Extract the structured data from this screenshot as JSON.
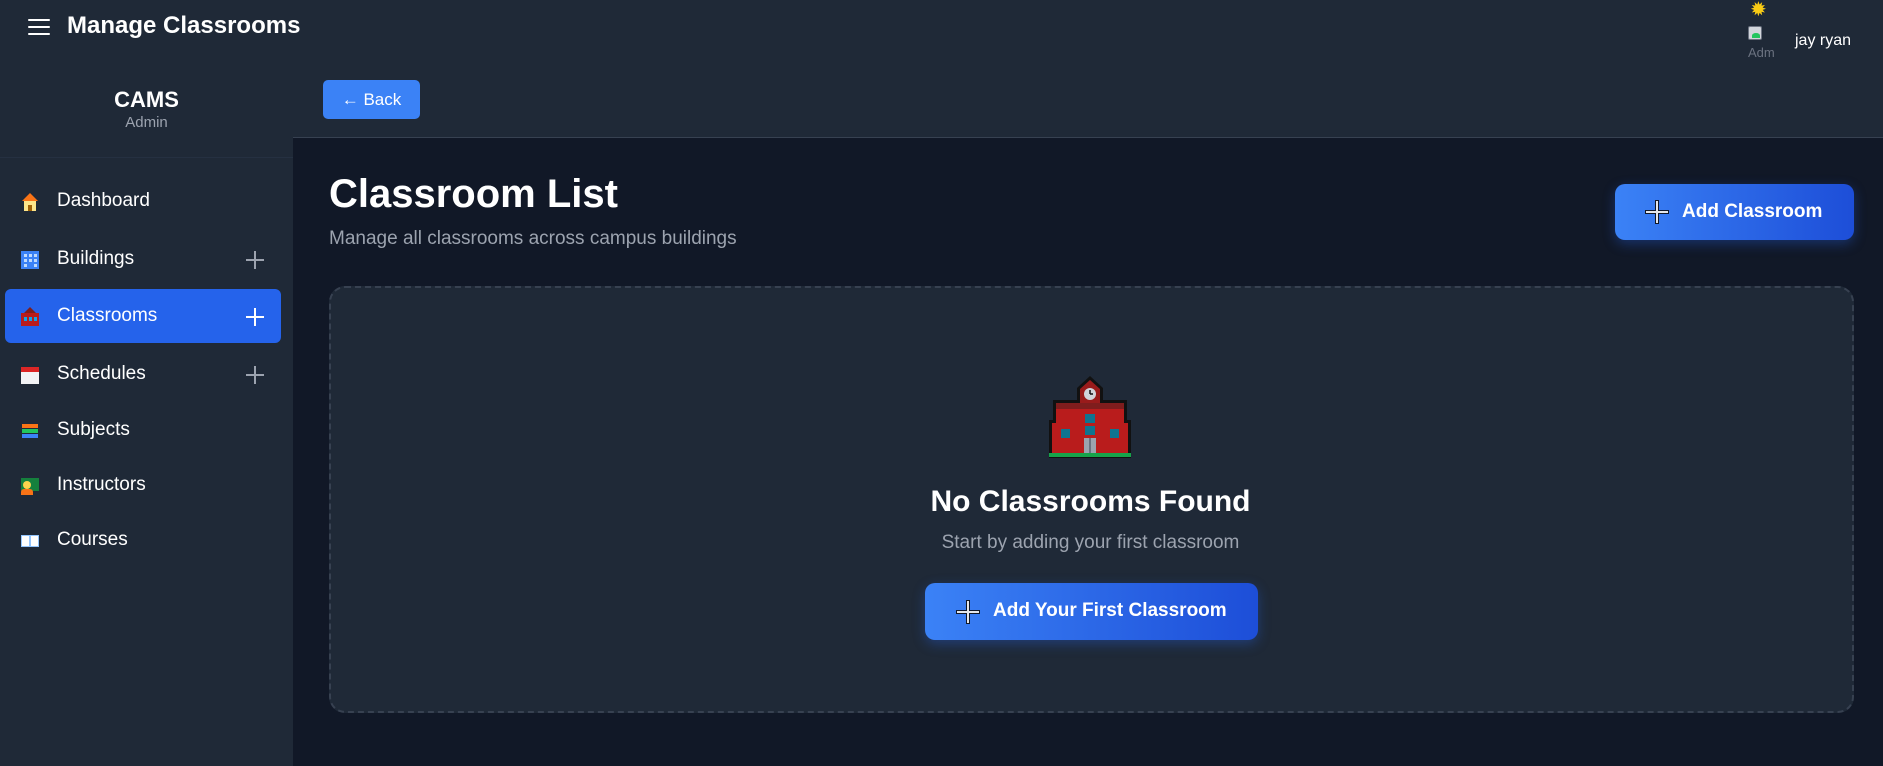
{
  "header": {
    "title": "Manage Classrooms",
    "user_name": "jay ryan",
    "avatar_alt": "Adm"
  },
  "sidebar": {
    "brand": "CAMS",
    "role": "Admin",
    "items": [
      {
        "label": "Dashboard",
        "icon": "house-icon",
        "expandable": false,
        "active": false
      },
      {
        "label": "Buildings",
        "icon": "building-icon",
        "expandable": true,
        "active": false
      },
      {
        "label": "Classrooms",
        "icon": "school-icon",
        "expandable": true,
        "active": true
      },
      {
        "label": "Schedules",
        "icon": "calendar-icon",
        "expandable": true,
        "active": false
      },
      {
        "label": "Subjects",
        "icon": "books-icon",
        "expandable": false,
        "active": false
      },
      {
        "label": "Instructors",
        "icon": "teacher-icon",
        "expandable": false,
        "active": false
      },
      {
        "label": "Courses",
        "icon": "open-book-icon",
        "expandable": false,
        "active": false
      }
    ]
  },
  "toolbar": {
    "back_label": "← Back"
  },
  "main": {
    "title": "Classroom List",
    "subtitle": "Manage all classrooms across campus buildings",
    "add_button_label": "Add Classroom",
    "empty_state": {
      "title": "No Classrooms Found",
      "subtitle": "Start by adding your first classroom",
      "button_label": "Add Your First Classroom"
    }
  },
  "colors": {
    "background": "#111827",
    "panel": "#1f2937",
    "accent": "#3b82f6",
    "accent_dark": "#1d4ed8",
    "muted_text": "#9ca3af"
  }
}
